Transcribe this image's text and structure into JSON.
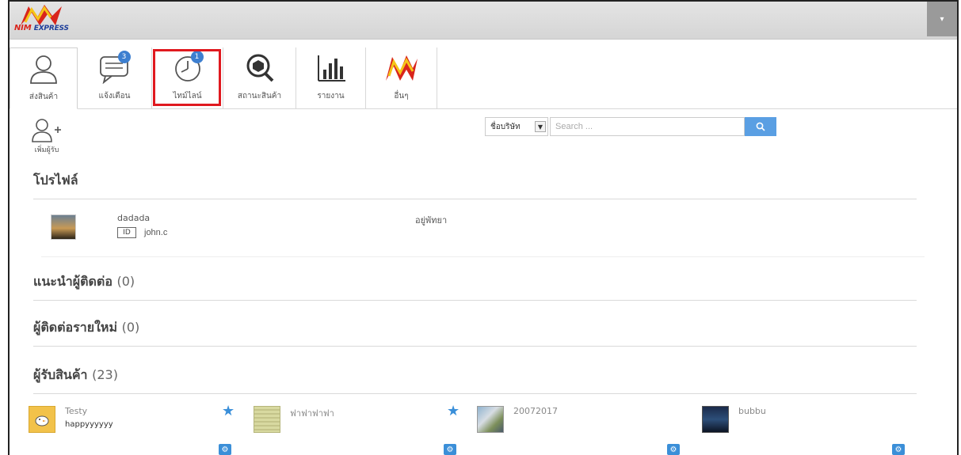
{
  "header": {
    "logo_text_main": "NIM",
    "logo_text_sub": "EXPRESS",
    "menu_toggle_glyph": "▾"
  },
  "tabs": [
    {
      "label": "ส่งสินค้า",
      "icon": "person-icon"
    },
    {
      "label": "แจ้งเตือน",
      "icon": "chat-icon",
      "badge": "3"
    },
    {
      "label": "ไทม์ไลน์",
      "icon": "clock-icon",
      "badge": "1",
      "highlighted": true
    },
    {
      "label": "สถานะสินค้า",
      "icon": "package-search-icon"
    },
    {
      "label": "รายงาน",
      "icon": "bar-chart-icon"
    },
    {
      "label": "อื่นๆ",
      "icon": "nim-logo-icon"
    }
  ],
  "toolbar": {
    "add_receiver_label": "เพิ่มผู้รับ",
    "company_select_value": "ชื่อบริษัท",
    "search_placeholder": "Search ..."
  },
  "profile": {
    "heading": "โปรไฟล์",
    "name": "dadada",
    "id_badge": "ID",
    "user_id": "john.c",
    "address": "อยู่พัทยา"
  },
  "sections": {
    "suggested": {
      "title": "แนะนำผู้ติดต่อ",
      "count": "(0)"
    },
    "new_contacts": {
      "title": "ผู้ติดต่อรายใหม่",
      "count": "(0)"
    },
    "receivers": {
      "title": "ผู้รับสินค้า",
      "count": "(23)"
    }
  },
  "receivers": [
    {
      "name": "Testy",
      "sub": "happyyyyyy",
      "starred": true
    },
    {
      "name": "ฟาฟาฟาฟา",
      "sub": "",
      "starred": true
    },
    {
      "name": "20072017",
      "sub": "",
      "starred": false
    },
    {
      "name": "bubbu",
      "sub": "",
      "starred": false
    }
  ],
  "colors": {
    "accent_blue": "#3b8fd8",
    "highlight_red": "#e0191f",
    "brand_red": "#d9251c",
    "brand_yellow": "#f5c518"
  }
}
